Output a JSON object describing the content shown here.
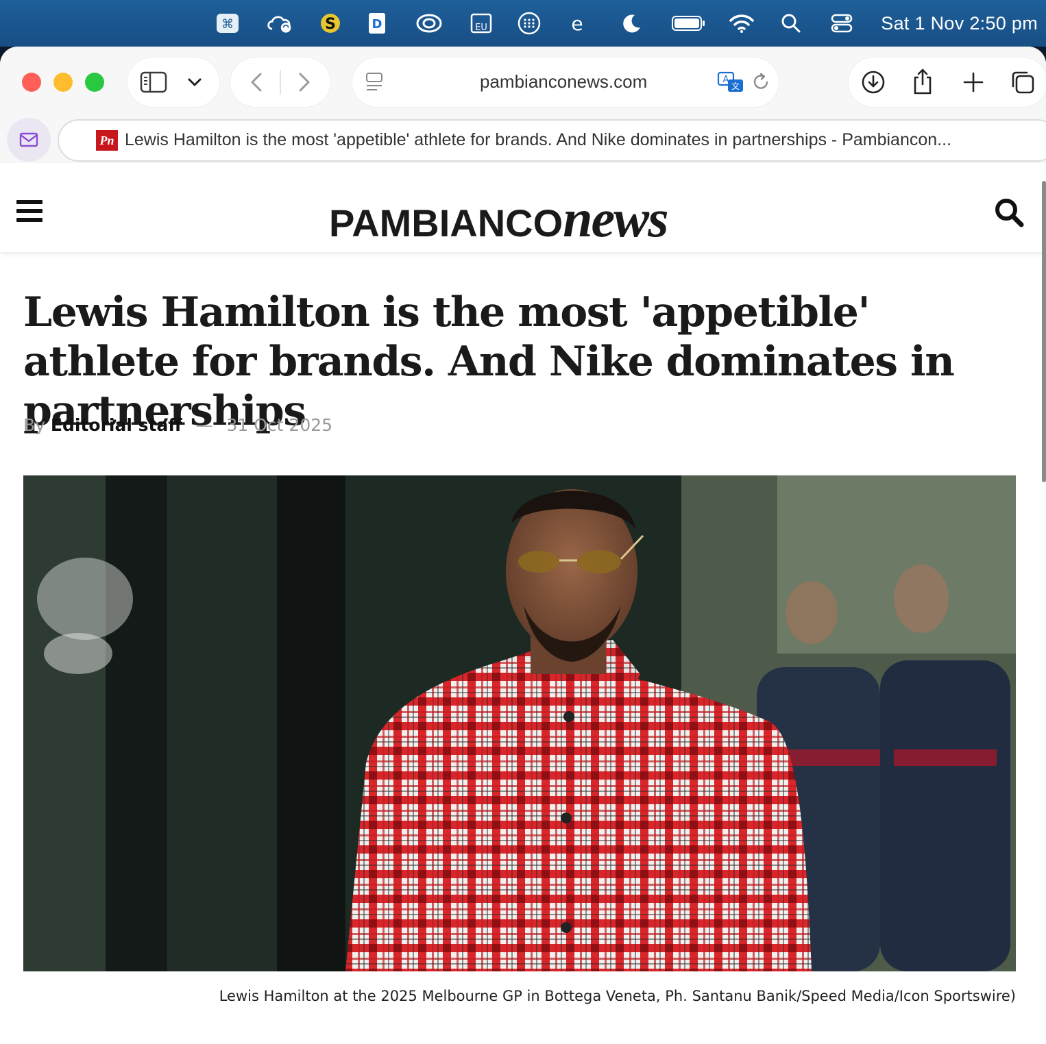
{
  "menubar": {
    "icons": [
      "command-icon",
      "creative-cloud-sync-icon",
      "dollar-app-icon",
      "dashlane-icon",
      "creative-cloud-icon",
      "eu-vpn-icon",
      "grid-app-icon",
      "edge-icon",
      "moon-icon",
      "battery-icon",
      "wifi-icon",
      "spotlight-icon",
      "control-center-icon"
    ],
    "clock": "Sat 1 Nov  2:50 pm"
  },
  "browser": {
    "url": "pambianconews.com",
    "tab_title": "Lewis Hamilton is the most 'appetible' athlete for brands. And Nike dominates in partnerships - Pambiancon...",
    "favicon_text": "Pn"
  },
  "site": {
    "logo_primary": "PAMBIANCO",
    "logo_secondary": "news"
  },
  "article": {
    "headline": "Lewis Hamilton is the most 'appetible' athlete for brands. And Nike dominates in partnerships",
    "byline_prefix": "By",
    "author": "Editorial staff",
    "separator": "—",
    "date": "31 Oct 2025",
    "caption": "Lewis Hamilton at the 2025 Melbourne GP in Bottega Veneta, Ph. Santanu Banik/Speed Media/Icon Sportswire)"
  },
  "colors": {
    "menubar": "#1f5f9a",
    "close": "#fe5f57",
    "minimize": "#febc2e",
    "zoom": "#28c840",
    "favicon": "#c8161d"
  }
}
